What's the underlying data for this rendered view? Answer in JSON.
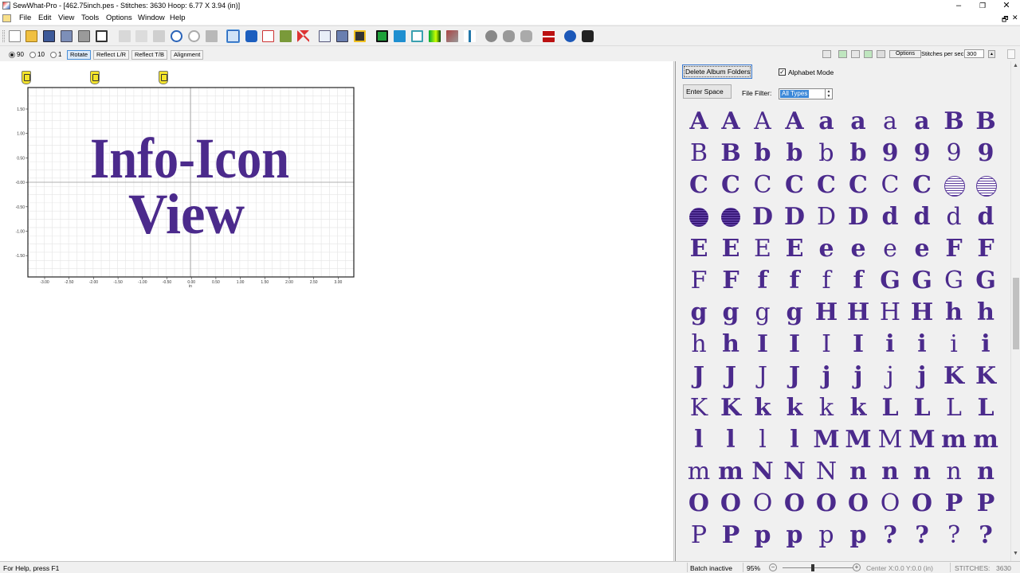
{
  "window": {
    "title": "SewWhat-Pro - [462.75inch.pes - Stitches: 3630  Hoop: 6.77 X 3.94 (in)]",
    "minimize": "–",
    "restore": "❐",
    "close": "✕",
    "doc_restore": "🗗",
    "doc_close": "✕"
  },
  "menu": {
    "items": [
      "File",
      "Edit",
      "View",
      "Tools",
      "Options",
      "Window",
      "Help"
    ]
  },
  "toolbar": {
    "buttons": [
      "new-icon",
      "open-icon",
      "save-icon",
      "save-as-icon",
      "print-icon",
      "print-preview-icon",
      "cut-icon",
      "copy-icon",
      "paste-icon",
      "undo-icon",
      "redo-icon",
      "resize-icon",
      "grid-view-icon",
      "bold-b-icon",
      "text-icon",
      "edit-stitch-icon",
      "split-icon",
      "page-icon",
      "save-all-icon",
      "disk-icon",
      "color-icon",
      "shirt-icon",
      "hoop-icon",
      "gradient-icon",
      "color-sort-icon",
      "needle-icon",
      "thread-icon",
      "thread-alt-icon",
      "thread-list-icon",
      "grid-color-icon",
      "help-icon",
      "whats-this-icon"
    ]
  },
  "options_bar": {
    "radios": [
      {
        "label": "90",
        "checked": true
      },
      {
        "label": "10",
        "checked": false
      },
      {
        "label": "1",
        "checked": false
      }
    ],
    "rotate": "Rotate",
    "reflect_lr": "Reflect L/R",
    "reflect_tb": "Reflect T/B",
    "alignment": "Alignment"
  },
  "playback": {
    "options": "Options",
    "speed_label": "Stitches per sec",
    "speed_value": "300"
  },
  "design": {
    "line1": "Info-Icon",
    "line2": "View",
    "thread_color": "#4b2a8c",
    "x_ticks": [
      "-3.00",
      "-2.50",
      "-2.00",
      "-1.50",
      "-1.00",
      "-0.50",
      "0.00",
      "0.50",
      "1.00",
      "1.50",
      "2.00",
      "2.50",
      "3.00"
    ],
    "y_ticks": [
      "1.50",
      "1.00",
      "0.50",
      "-0.00",
      "-0.50",
      "-1.00",
      "-1.50"
    ],
    "unit": "in"
  },
  "panel": {
    "delete_album": "Delete Album Folders",
    "enter_space": "Enter Space",
    "alphabet_mode_label": "Alphabet Mode",
    "alphabet_mode_checked": "✓",
    "file_filter_label": "File Filter:",
    "file_filter_value": "All Types",
    "glyph_color": "#4b2a8c",
    "glyphs": [
      "A",
      "A",
      "A",
      "A",
      "a",
      "a",
      "a",
      "a",
      "B",
      "B",
      "B",
      "B",
      "b",
      "b",
      "b",
      "b",
      "9",
      "9",
      "9",
      "9",
      "C",
      "C",
      "C",
      "C",
      "C",
      "C",
      "C",
      "C",
      "●",
      "●",
      "●",
      "●",
      "D",
      "D",
      "D",
      "D",
      "d",
      "d",
      "d",
      "d",
      "E",
      "E",
      "E",
      "E",
      "e",
      "e",
      "e",
      "e",
      "F",
      "F",
      "F",
      "F",
      "f",
      "f",
      "f",
      "f",
      "G",
      "G",
      "G",
      "G",
      "g",
      "g",
      "g",
      "g",
      "H",
      "H",
      "H",
      "H",
      "h",
      "h",
      "h",
      "h",
      "I",
      "I",
      "I",
      "I",
      "i",
      "i",
      "i",
      "i",
      "J",
      "J",
      "J",
      "J",
      "j",
      "j",
      "j",
      "j",
      "K",
      "K",
      "K",
      "K",
      "k",
      "k",
      "k",
      "k",
      "L",
      "L",
      "L",
      "L",
      "l",
      "l",
      "l",
      "l",
      "M",
      "M",
      "M",
      "M",
      "m",
      "m",
      "m",
      "m",
      "N",
      "N",
      "N",
      "n",
      "n",
      "n",
      "n",
      "n",
      "O",
      "O",
      "O",
      "O",
      "O",
      "O",
      "O",
      "O",
      "P",
      "P",
      "P",
      "P",
      "p",
      "p",
      "p",
      "p",
      "?",
      "?",
      "?",
      "?"
    ]
  },
  "status": {
    "help": "For Help, press F1",
    "batch": "Batch inactive",
    "zoom": "95%",
    "zoom_minus": "−",
    "zoom_plus": "+",
    "center": "Center X:0.0  Y:0.0 (in)",
    "stitches_label": "STITCHES:",
    "stitches_value": "3630"
  }
}
